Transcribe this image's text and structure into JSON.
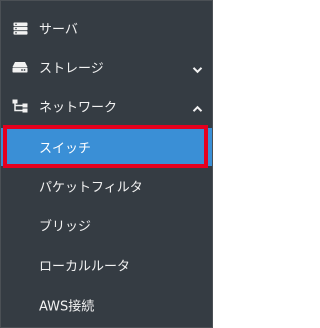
{
  "menu": {
    "items": [
      {
        "label": "サーバ",
        "icon": "server-icon"
      },
      {
        "label": "ストレージ",
        "icon": "storage-icon",
        "chevron": "chevron-down-icon"
      },
      {
        "label": "ネットワーク",
        "icon": "network-icon",
        "chevron": "chevron-up-icon"
      }
    ],
    "network_sub": [
      {
        "label": "スイッチ",
        "selected": true
      },
      {
        "label": "パケットフィルタ"
      },
      {
        "label": "ブリッジ"
      },
      {
        "label": "ローカルルータ"
      },
      {
        "label": "AWS接続"
      }
    ]
  },
  "colors": {
    "sidebar_bg": "#353c43",
    "text": "#f2f2f2",
    "active_bg": "#3a8fd6",
    "highlight_border": "#e5001e"
  }
}
